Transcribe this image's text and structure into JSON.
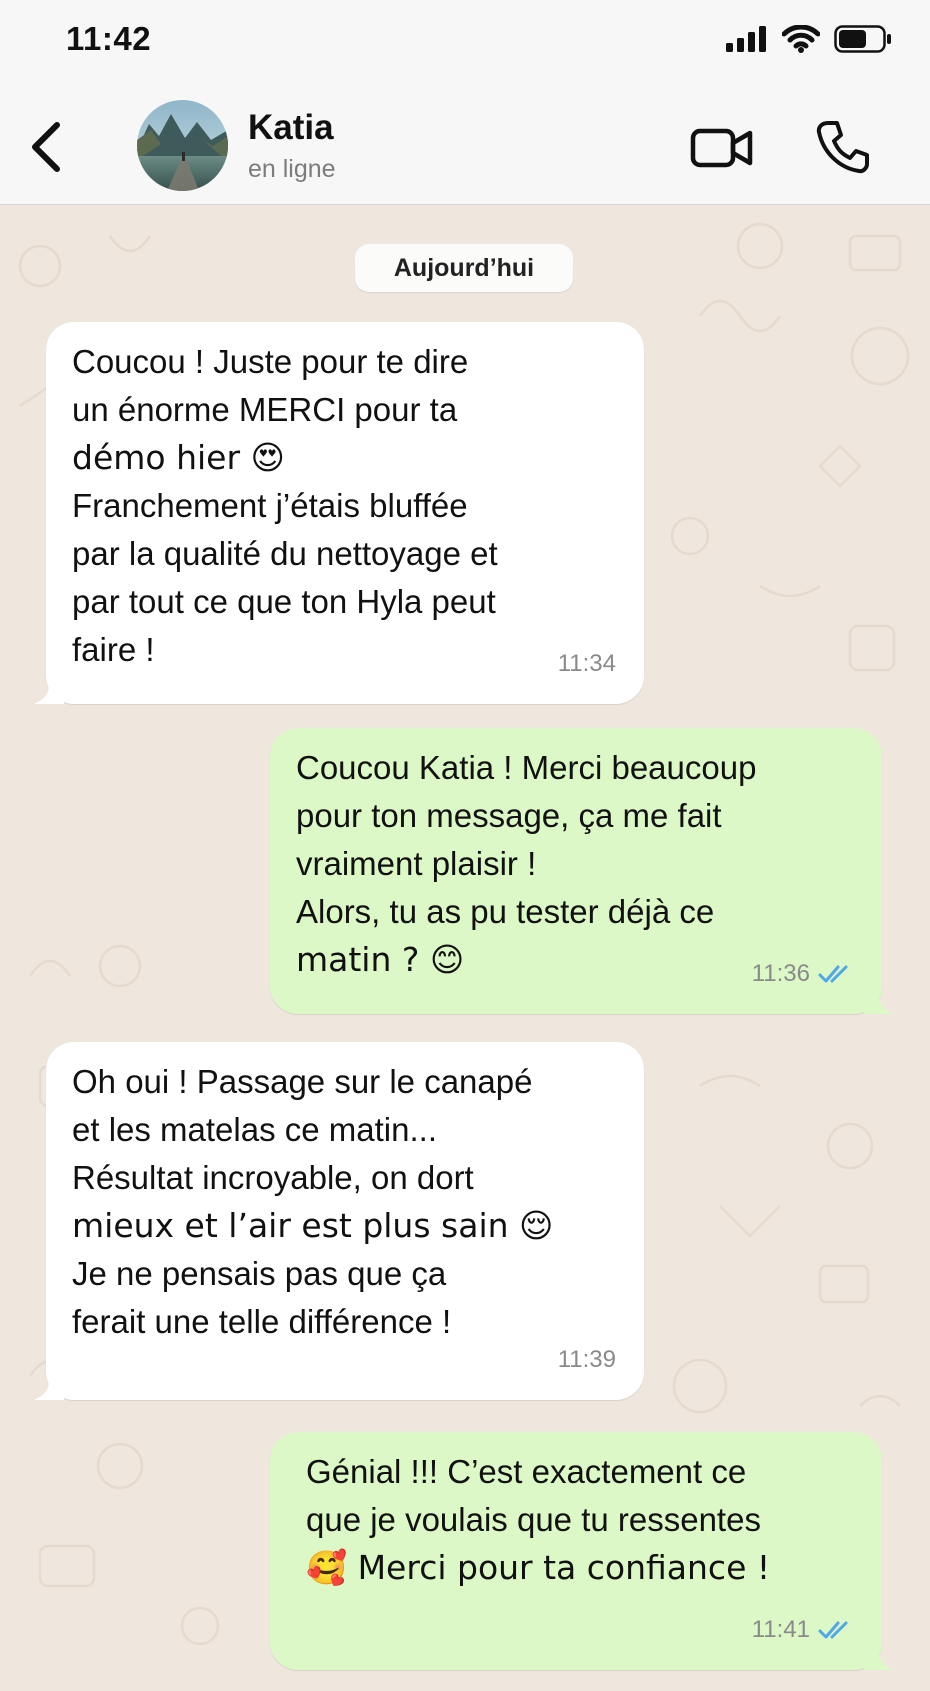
{
  "status_bar": {
    "time": "11:42"
  },
  "header": {
    "contact_name": "Katia",
    "contact_status": "en ligne"
  },
  "chat": {
    "date_separator": "Aujourd’hui",
    "messages": [
      {
        "direction": "incoming",
        "lines": [
          "Coucou ! Juste pour te dire",
          "un énorme MERCI pour ta",
          "démo hier 😍",
          "Franchement j’étais bluffée",
          "par la qualité du nettoyage et",
          "par tout ce que ton Hyla peut",
          "faire !"
        ],
        "time": "11:34"
      },
      {
        "direction": "outgoing",
        "lines": [
          "Coucou Katia ! Merci beaucoup",
          "pour ton message, ça me fait",
          "vraiment plaisir !",
          "Alors, tu as pu tester déjà ce",
          "matin ? 😊"
        ],
        "time": "11:36",
        "read": true
      },
      {
        "direction": "incoming",
        "lines": [
          "Oh oui ! Passage sur le canapé",
          "et les matelas ce matin...",
          "Résultat incroyable, on dort",
          "mieux et l’air est plus sain 😌",
          "Je ne pensais pas que ça",
          "ferait une telle différence !"
        ],
        "time": "11:39"
      },
      {
        "direction": "outgoing",
        "lines": [
          "Génial !!! C’est exactement ce",
          "que je voulais que tu ressentes",
          "🥰 Merci pour ta confiance !"
        ],
        "time": "11:41",
        "read": true
      }
    ]
  },
  "colors": {
    "incoming_bubble": "#ffffff",
    "outgoing_bubble": "#dcf8c6",
    "chat_background": "#efe7dd",
    "read_ticks": "#4fa6e8"
  },
  "icons": [
    "back-chevron-icon",
    "video-camera-icon",
    "phone-icon",
    "signal-icon",
    "wifi-icon",
    "battery-icon",
    "double-check-icon"
  ]
}
